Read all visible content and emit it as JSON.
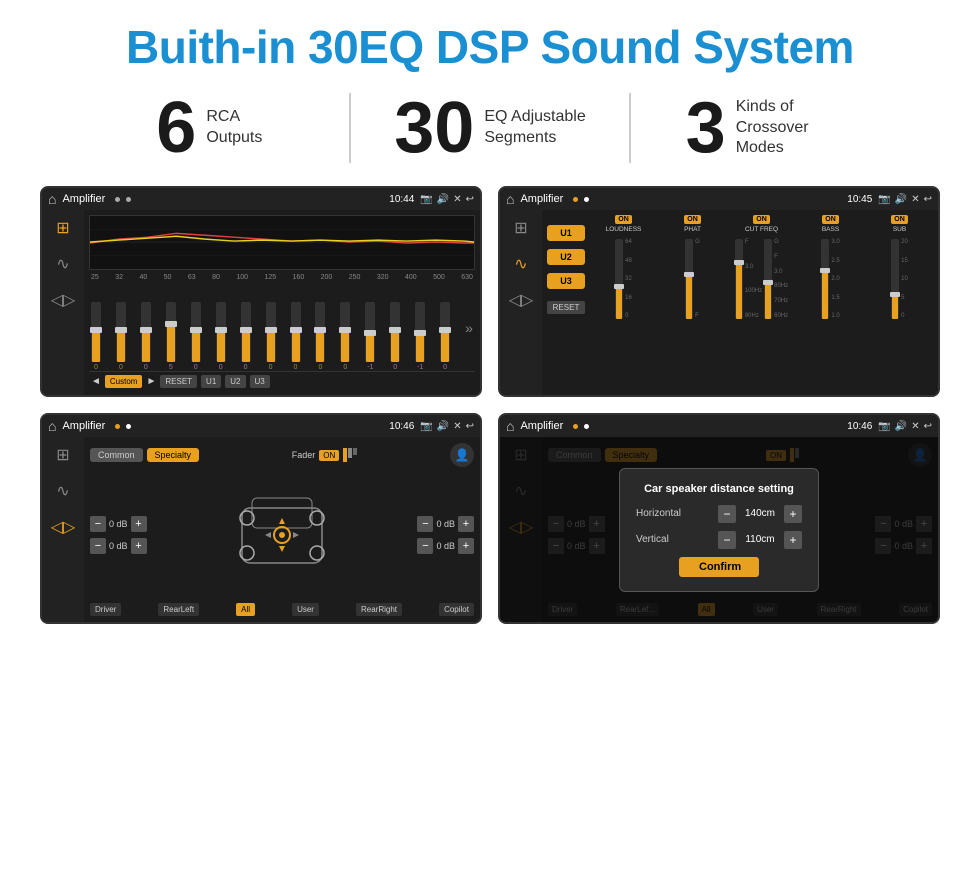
{
  "header": {
    "title": "Buith-in 30EQ DSP Sound System"
  },
  "stats": [
    {
      "number": "6",
      "label": "RCA\nOutputs"
    },
    {
      "number": "30",
      "label": "EQ Adjustable\nSegments"
    },
    {
      "number": "3",
      "label": "Kinds of\nCrossover Modes"
    }
  ],
  "screens": [
    {
      "id": "screen1",
      "title": "Amplifier",
      "time": "10:44",
      "type": "eq"
    },
    {
      "id": "screen2",
      "title": "Amplifier",
      "time": "10:45",
      "type": "crossover"
    },
    {
      "id": "screen3",
      "title": "Amplifier",
      "time": "10:46",
      "type": "speaker"
    },
    {
      "id": "screen4",
      "title": "Amplifier",
      "time": "10:46",
      "type": "speaker-dialog"
    }
  ],
  "eq": {
    "freqs": [
      "25",
      "32",
      "40",
      "50",
      "63",
      "80",
      "100",
      "125",
      "160",
      "200",
      "250",
      "320",
      "400",
      "500",
      "630"
    ],
    "values": [
      "0",
      "0",
      "0",
      "5",
      "0",
      "0",
      "0",
      "0",
      "0",
      "0",
      "0",
      "-1",
      "0",
      "-1",
      "0"
    ],
    "modes": [
      "Custom",
      "RESET",
      "U1",
      "U2",
      "U3"
    ]
  },
  "crossover": {
    "presets": [
      "U1",
      "U2",
      "U3"
    ],
    "channels": [
      {
        "name": "LOUDNESS",
        "on": true
      },
      {
        "name": "PHAT",
        "on": true
      },
      {
        "name": "CUT FREQ",
        "on": true
      },
      {
        "name": "BASS",
        "on": true
      },
      {
        "name": "SUB",
        "on": true
      }
    ]
  },
  "speaker": {
    "tabs": [
      "Common",
      "Specialty"
    ],
    "fader": "Fader",
    "controls_left": [
      "0 dB",
      "0 dB"
    ],
    "controls_right": [
      "0 dB",
      "0 dB"
    ],
    "bottom_labels": [
      "Driver",
      "RearLeft",
      "All",
      "User",
      "RearRight",
      "Copilot"
    ]
  },
  "dialog": {
    "title": "Car speaker distance setting",
    "horizontal_label": "Horizontal",
    "horizontal_value": "140cm",
    "vertical_label": "Vertical",
    "vertical_value": "110cm",
    "confirm_label": "Confirm"
  }
}
